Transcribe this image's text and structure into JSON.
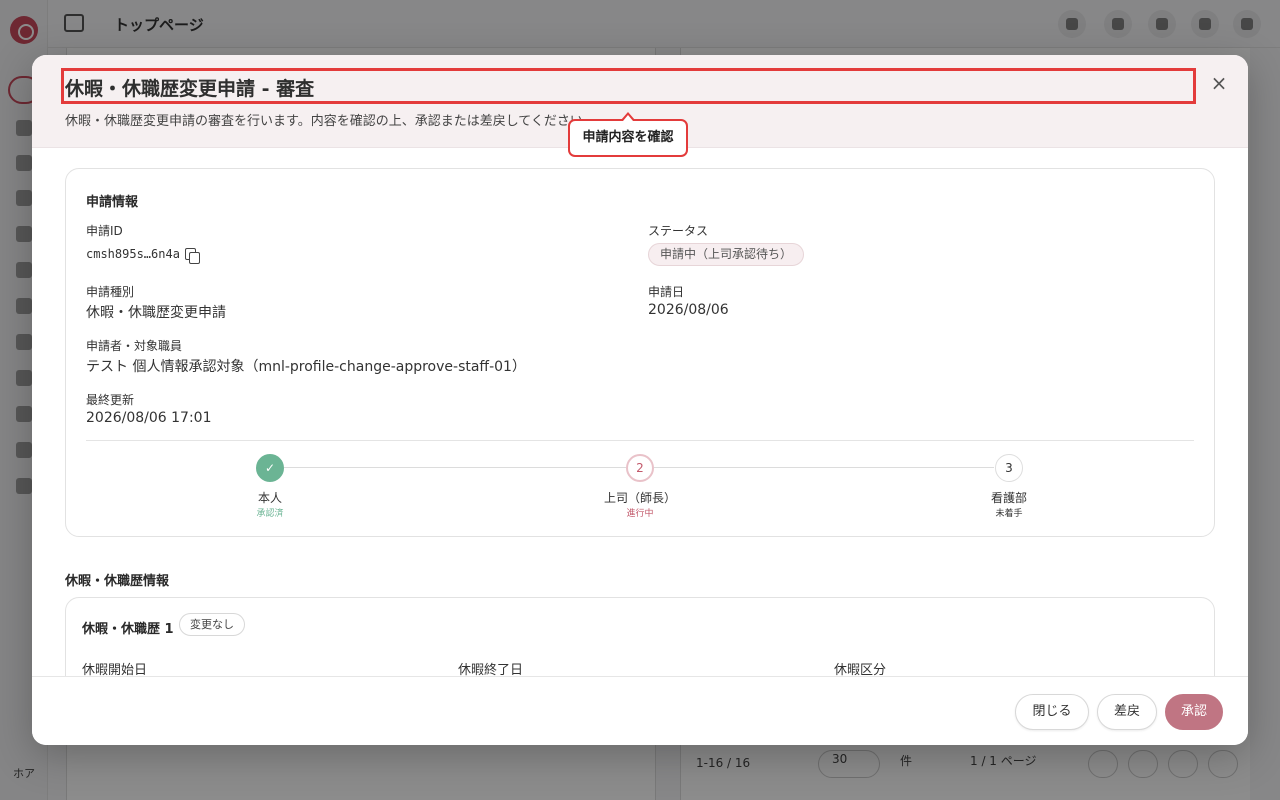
{
  "background": {
    "app_title": "トップページ",
    "user_initials": "ホア",
    "sidebar_icons": [
      "user-icon",
      "calendar-icon",
      "chat-icon",
      "document-icon",
      "user-icon",
      "document-icon",
      "check-icon",
      "users-icon",
      "list-icon",
      "org-icon",
      "document-icon"
    ],
    "header_icons": [
      "chat-icon",
      "calendar-icon",
      "bell-icon",
      "chat-icon",
      "avatar-icon"
    ],
    "footer_count": "1-16 / 16",
    "page_size": "30",
    "page_size_unit": "件",
    "page_indicator": "1 / 1 ページ"
  },
  "modal": {
    "title": "休暇・休職歴変更申請 - 審査",
    "description": "休暇・休職歴変更申請の審査を行います。内容を確認の上、承認または差戻してください。",
    "close_icon": "×",
    "callout": "申請内容を確認",
    "info_card": {
      "title": "申請情報",
      "id_label": "申請ID",
      "id_value": "cmsh895s…6n4a",
      "status_label": "ステータス",
      "status_value": "申請中（上司承認待ち）",
      "type_label": "申請種別",
      "type_value": "休暇・休職歴変更申請",
      "date_label": "申請日",
      "date_value": "2026/08/06",
      "applicant_label": "申請者・対象職員",
      "applicant_value": "テスト 個人情報承認対象（mnl-profile-change-approve-staff-01）",
      "updated_label": "最終更新",
      "updated_value": "2026/08/06 17:01"
    },
    "steps": [
      {
        "marker": "✓",
        "name": "本人",
        "status": "承認済",
        "state": "done"
      },
      {
        "marker": "2",
        "name": "上司（師長）",
        "status": "進行中",
        "state": "active"
      },
      {
        "marker": "3",
        "name": "看護部",
        "status": "未着手",
        "state": "todo"
      }
    ],
    "leave_section": {
      "title": "休暇・休職歴情報",
      "card_title": "休暇・休職歴 1",
      "tag": "変更なし",
      "columns": [
        "休暇開始日",
        "休暇終了日",
        "休暇区分"
      ]
    },
    "buttons": {
      "close": "閉じる",
      "return": "差戻",
      "approve": "承認"
    }
  },
  "colors": {
    "accent": "#c07583",
    "highlight": "#e33b3b",
    "done": "#6bb494",
    "active_text": "#c2586a"
  }
}
